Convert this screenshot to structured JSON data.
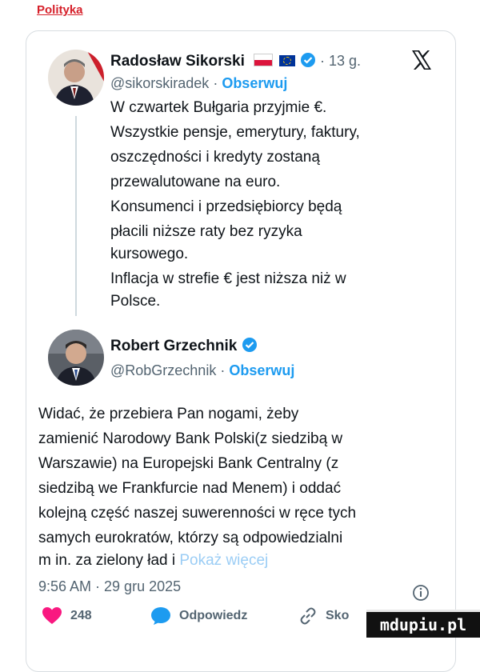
{
  "header": {
    "section": "Polityka"
  },
  "post1": {
    "name": "Radosław Sikorski",
    "time": "· 13 g.",
    "handle": "@sikorskiradek",
    "sep": " · ",
    "follow": "Obserwuj",
    "lines": [
      "W czwartek Bułgaria przyjmie €.",
      "Wszystkie pensje, emerytury, faktury,",
      "oszczędności i kredyty zostaną",
      "przewalutowane na euro.",
      "Konsumenci i przedsiębiorcy będą",
      "płacili niższe raty bez ryzyka",
      "kursowego.",
      "Inflacja w strefie € jest niższa niż w",
      "Polsce."
    ]
  },
  "post2": {
    "name": "Robert Grzechnik",
    "handle": "@RobGrzechnik",
    "sep": " · ",
    "follow": "Obserwuj",
    "lines": [
      "Widać, że przebiera Pan nogami, żeby",
      "zamienić Narodowy Bank Polski(z siedzibą w",
      "Warszawie) na Europejski Bank Centralny (z",
      "siedzibą we Frankfurcie nad Menem) i oddać",
      "kolejną część naszej suwerenności w ręce tych",
      "samych eurokratów, którzy są odpowiedzialni"
    ],
    "last_line": "m in. za zielony ład i ",
    "show_more": "Pokaż więcej",
    "timestamp": "9:56 AM · 29 gru 2025"
  },
  "actions": {
    "likes": "248",
    "reply": "Odpowiedz",
    "copy": "Sko"
  },
  "watermark": "mdupiu.pl",
  "icons": {
    "platform": "x-logo-icon",
    "verified": "verified-badge-icon",
    "info": "info-icon",
    "like": "heart-icon",
    "reply": "reply-bubble-icon",
    "copy": "link-icon"
  },
  "colors": {
    "accent": "#1d9bf0",
    "header": "#d6202a",
    "like": "#f91880"
  }
}
